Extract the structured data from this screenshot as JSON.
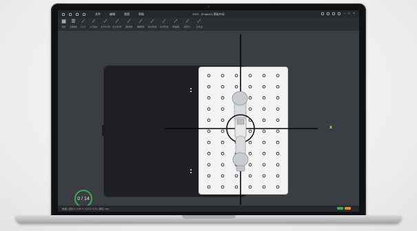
{
  "titlebar": {
    "menu": [
      "文件",
      "编辑",
      "视图",
      "帮助"
    ],
    "title": "2024 - [Project1] 模板布局"
  },
  "toolbar": {
    "tools": [
      {
        "label": "新建",
        "icon": "grid"
      },
      {
        "label": "新建模板",
        "icon": "layers"
      },
      {
        "label": "1 关节",
        "icon": "robot-arm"
      },
      {
        "label": "关节运动",
        "icon": "robot-arm"
      },
      {
        "label": "笛卡尔空间",
        "icon": "robot-arm"
      },
      {
        "label": "笛卡尔手势",
        "icon": "robot-arm"
      },
      {
        "label": "路径规划",
        "icon": "robot-arm"
      },
      {
        "label": "碰撞检测",
        "icon": "robot-arm"
      },
      {
        "label": "运动学仿真",
        "icon": "robot-arm"
      },
      {
        "label": "动力学仿真",
        "icon": "robot-arm"
      },
      {
        "label": "离线编程",
        "icon": "robot-arm"
      },
      {
        "label": "模型导入",
        "icon": "robot-arm"
      },
      {
        "label": "工具标定",
        "icon": "robot-arm"
      }
    ]
  },
  "viewport": {
    "axis_marker": "x",
    "counter": "0 / 14"
  },
  "statusbar": {
    "text": "就绪 | 坐标 X: 0.00 Y: 0.00 Z: 0.00 | 单位: mm"
  },
  "colors": {
    "accent": "#3fa84f",
    "axis": "#e2e24a",
    "plate": "#f3f3f3",
    "enclosure": "#1e2023",
    "canvas": "#3a3e43"
  }
}
